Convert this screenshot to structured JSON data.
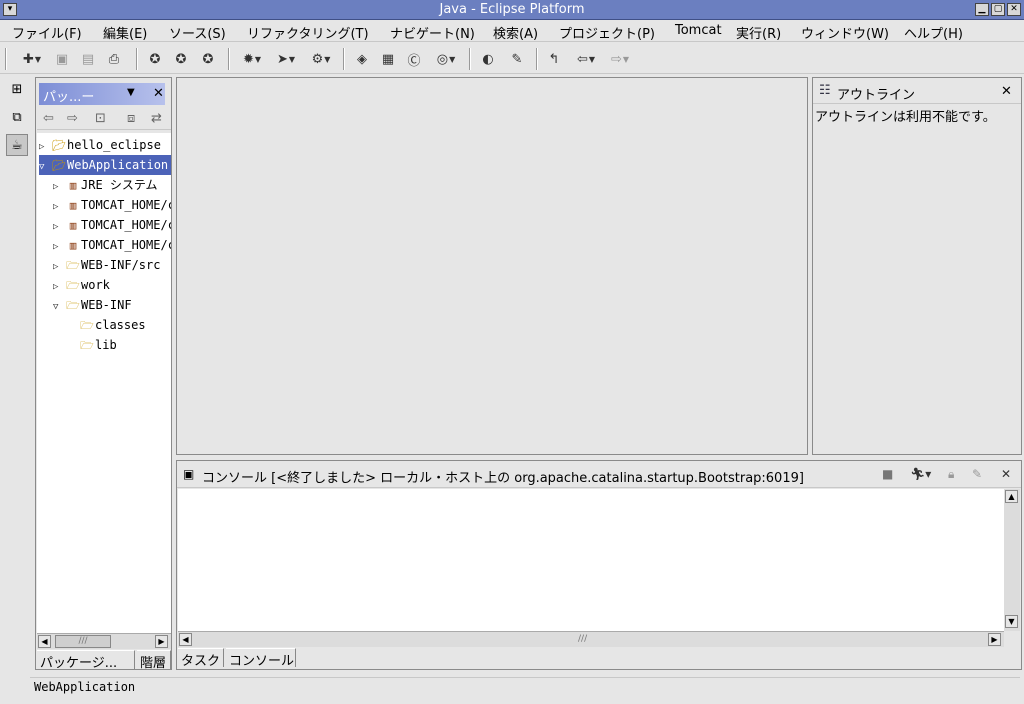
{
  "window": {
    "title": "Java - Eclipse Platform"
  },
  "menu": [
    "ファイル(F)",
    "編集(E)",
    "ソース(S)",
    "リファクタリング(T)",
    "ナビゲート(N)",
    "検索(A)",
    "プロジェクト(P)",
    "Tomcat",
    "実行(R)",
    "ウィンドウ(W)",
    "ヘルプ(H)"
  ],
  "package_explorer": {
    "tab_label": "パッ...ー",
    "tree": [
      {
        "label": "hello_eclipse",
        "level": 0,
        "toggle": "closed",
        "icon": "project-icon",
        "selected": false
      },
      {
        "label": "WebApplication",
        "level": 0,
        "toggle": "open",
        "icon": "project-icon",
        "selected": true
      },
      {
        "label": "JRE システム",
        "level": 1,
        "toggle": "closed",
        "icon": "library-icon",
        "selected": false
      },
      {
        "label": "TOMCAT_HOME/c",
        "level": 1,
        "toggle": "closed",
        "icon": "jar-icon",
        "selected": false
      },
      {
        "label": "TOMCAT_HOME/c",
        "level": 1,
        "toggle": "closed",
        "icon": "jar-icon",
        "selected": false
      },
      {
        "label": "TOMCAT_HOME/c",
        "level": 1,
        "toggle": "closed",
        "icon": "jar-icon",
        "selected": false
      },
      {
        "label": "WEB-INF/src",
        "level": 1,
        "toggle": "closed",
        "icon": "source-folder-icon",
        "selected": false
      },
      {
        "label": "work",
        "level": 1,
        "toggle": "closed",
        "icon": "source-folder-icon",
        "selected": false
      },
      {
        "label": "WEB-INF",
        "level": 1,
        "toggle": "open",
        "icon": "folder-open-icon",
        "selected": false
      },
      {
        "label": "classes",
        "level": 2,
        "toggle": "none",
        "icon": "folder-icon",
        "selected": false
      },
      {
        "label": "lib",
        "level": 2,
        "toggle": "none",
        "icon": "folder-icon",
        "selected": false
      }
    ],
    "bottom_tabs": [
      "パッケージ...",
      "階層"
    ]
  },
  "outline": {
    "title": "アウトライン",
    "message": "アウトラインは利用不能です。"
  },
  "console": {
    "title": "コンソール [<終了しました> ローカル・ホスト上の org.apache.catalina.startup.Bootstrap:6019]",
    "bottom_tabs": [
      "タスク",
      "コンソール"
    ]
  },
  "status": {
    "text": "WebApplication"
  }
}
